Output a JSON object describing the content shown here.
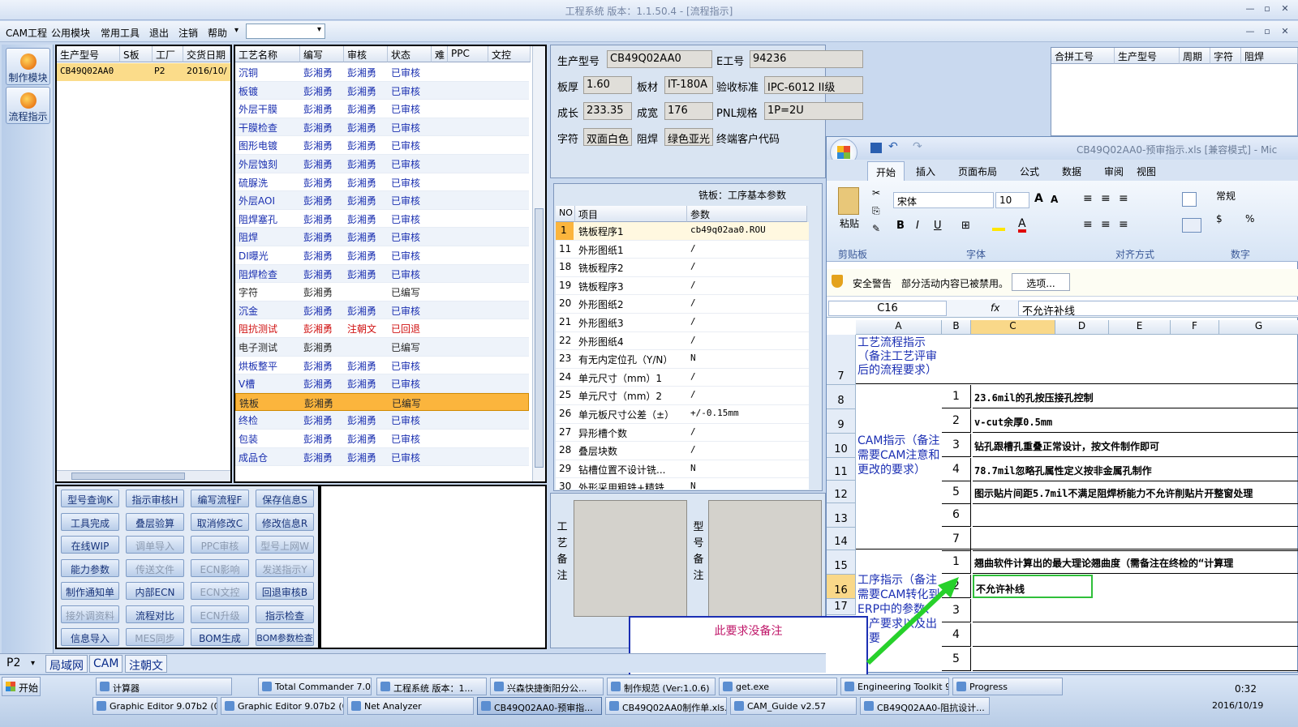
{
  "title": "工程系统  版本：1.1.50.4 - [流程指示]",
  "menu": [
    "CAM工程",
    "公用模块",
    "常用工具",
    "退出",
    "注销",
    "帮助"
  ],
  "menu_arrow": "▾",
  "side": [
    "制作模块",
    "流程指示"
  ],
  "models": {
    "headers": [
      "生产型号",
      "S板",
      "工厂",
      "交货日期"
    ],
    "row": [
      "CB49Q02AA0",
      "P2",
      "2016/10/"
    ]
  },
  "proc": {
    "headers": [
      "工艺名称",
      "编写",
      "审核",
      "状态",
      "难",
      "PPC",
      "文控"
    ],
    "rows": [
      [
        "沉铜",
        "彭湘勇",
        "彭湘勇",
        "已审核"
      ],
      [
        "板镀",
        "彭湘勇",
        "彭湘勇",
        "已审核"
      ],
      [
        "外层干膜",
        "彭湘勇",
        "彭湘勇",
        "已审核"
      ],
      [
        "干膜检查",
        "彭湘勇",
        "彭湘勇",
        "已审核"
      ],
      [
        "图形电镀",
        "彭湘勇",
        "彭湘勇",
        "已审核"
      ],
      [
        "外层蚀刻",
        "彭湘勇",
        "彭湘勇",
        "已审核"
      ],
      [
        "硫脲洗",
        "彭湘勇",
        "彭湘勇",
        "已审核"
      ],
      [
        "外层AOI",
        "彭湘勇",
        "彭湘勇",
        "已审核"
      ],
      [
        "阻焊塞孔",
        "彭湘勇",
        "彭湘勇",
        "已审核"
      ],
      [
        "阻焊",
        "彭湘勇",
        "彭湘勇",
        "已审核"
      ],
      [
        "DI曝光",
        "彭湘勇",
        "彭湘勇",
        "已审核"
      ],
      [
        "阻焊检查",
        "彭湘勇",
        "彭湘勇",
        "已审核"
      ],
      [
        "字符",
        "彭湘勇",
        "",
        "已编写"
      ],
      [
        "沉金",
        "彭湘勇",
        "彭湘勇",
        "已审核"
      ],
      [
        "阻抗测试",
        "彭湘勇",
        "注朝文",
        "已回退"
      ],
      [
        "电子测试",
        "彭湘勇",
        "",
        "已编写"
      ],
      [
        "烘板整平",
        "彭湘勇",
        "彭湘勇",
        "已审核"
      ],
      [
        "V槽",
        "彭湘勇",
        "彭湘勇",
        "已审核"
      ],
      [
        "铣板",
        "彭湘勇",
        "",
        "已编写"
      ],
      [
        "终检",
        "彭湘勇",
        "彭湘勇",
        "已审核"
      ],
      [
        "包装",
        "彭湘勇",
        "彭湘勇",
        "已审核"
      ],
      [
        "成品仓",
        "彭湘勇",
        "彭湘勇",
        "已审核"
      ]
    ]
  },
  "buttons": [
    [
      "型号查询K",
      "指示审核H",
      "编写流程F",
      "保存信息S"
    ],
    [
      "工具完成",
      "叠层验算",
      "取消修改C",
      "修改信息R"
    ],
    [
      "在线WIP",
      "调单导入",
      "PPC审核",
      "型号上网W"
    ],
    [
      "能力参数",
      "传送文件",
      "ECN影响",
      "发送指示Y"
    ],
    [
      "制作通知单",
      "内部ECN",
      "ECN文控",
      "回退审核B"
    ],
    [
      "接外调资料",
      "流程对比",
      "ECN升级",
      "指示检查"
    ],
    [
      "信息导入",
      "MES同步",
      "BOM生成",
      "BOM参数检查"
    ]
  ],
  "info": {
    "型号label": "生产型号",
    "型号": "CB49Q02AA0",
    "E工号label": "E工号",
    "E工号": "94236",
    "板厚label": "板厚",
    "板厚": "1.60",
    "板材label": "板材",
    "板材": "IT-180A",
    "验收label": "验收标准",
    "验收": "IPC-6012 II级",
    "成长label": "成长",
    "成长": "233.35",
    "成宽label": "成宽",
    "成宽": "176",
    "PNL label": "PNL规格",
    "PNL": "1P=2U",
    "字符label": "字符",
    "字符": "双面白色",
    "阻焊label": "阻焊",
    "阻焊": "绿色亚光",
    "终端label": "终端客户代码"
  },
  "merge_headers": [
    "合拼工号",
    "生产型号",
    "周期",
    "字符",
    "阻焊"
  ],
  "params": {
    "title": "铣板：工序基本参数",
    "headers": [
      "NO",
      "项目",
      "参数"
    ],
    "rows": [
      [
        "1",
        "铣板程序1",
        "cb49q02aa0.ROU"
      ],
      [
        "11",
        "外形图纸1",
        "/"
      ],
      [
        "18",
        "铣板程序2",
        "/"
      ],
      [
        "19",
        "铣板程序3",
        "/"
      ],
      [
        "20",
        "外形图纸2",
        "/"
      ],
      [
        "21",
        "外形图纸3",
        "/"
      ],
      [
        "22",
        "外形图纸4",
        "/"
      ],
      [
        "23",
        "有无内定位孔（Y/N）",
        "N"
      ],
      [
        "24",
        "单元尺寸（mm）1",
        "/"
      ],
      [
        "25",
        "单元尺寸（mm）2",
        "/"
      ],
      [
        "26",
        "单元板尺寸公差（±）",
        "+/-0.15mm"
      ],
      [
        "27",
        "异形槽个数",
        "/"
      ],
      [
        "28",
        "叠层块数",
        "/"
      ],
      [
        "29",
        "钻槽位置不设计铣...",
        "N"
      ],
      [
        "30",
        "外形采用粗铣+精铣...",
        "N"
      ]
    ]
  },
  "remark1": "工艺备注",
  "remark2": "型号备注",
  "excel": {
    "title": "CB49Q02AA0-预审指示.xls  [兼容模式] - Mic",
    "tabs": [
      "开始",
      "插入",
      "页面布局",
      "公式",
      "数据",
      "审阅",
      "视图"
    ],
    "font": "宋体",
    "size": "10",
    "format": "常规",
    "groups": [
      "剪贴板",
      "字体",
      "对齐方式",
      "数字"
    ],
    "paste": "粘贴",
    "warn_label": "安全警告",
    "warn_text": "部分活动内容已被禁用。",
    "warn_btn": "选项...",
    "cellref": "C16",
    "fx": "fx",
    "formula": "不允许补线",
    "cols": [
      "A",
      "B",
      "C",
      "D",
      "E",
      "F",
      "G"
    ],
    "rows": [
      "7",
      "8",
      "9",
      "10",
      "11",
      "12",
      "13",
      "14",
      "15",
      "16",
      "17"
    ],
    "a7": "工艺流程指示（备注工艺评审后的流程要求）",
    "a10": "CAM指示（备注需要CAM注意和更改的要求）",
    "a16": "工序指示（备注需要CAM转化到ERP中的参数、生产要求以及出货要",
    "b": [
      "1",
      "2",
      "3",
      "4",
      "5",
      "6",
      "7",
      "1",
      "2",
      "3",
      "4",
      "5"
    ],
    "c": [
      "23.6mil的孔按压接孔控制",
      "v-cut余厚0.5mm",
      "钻孔跟槽孔重叠正常设计，按文件制作即可",
      "78.7mil忽略孔属性定义按非金属孔制作",
      "图示贴片间距5.7mil不满足阻焊桥能力不允许削贴片开整窗处理",
      "",
      "",
      "翘曲软件计算出的最大理论翘曲度（需备注在终检的“计算理",
      "不允许补线",
      "",
      "",
      ""
    ]
  },
  "callout": "此要求没备注",
  "tabs_bottom": [
    "P2",
    "局域网",
    "CAM",
    "注朝文"
  ],
  "taskbar": {
    "start": "开始",
    "row1": [
      "计算器",
      "Total Commander 7.0...",
      "工程系统  版本：1...",
      "兴森快捷衡阳分公...",
      "制作规范 (Ver:1.0.6)",
      "get.exe",
      "Engineering Toolkit 9....",
      "Progress"
    ],
    "row2": [
      "Graphic Editor 9.07b2 (0...",
      "Graphic Editor 9.07b2 (0...",
      "Net Analyzer",
      "CB49Q02AA0-预审指...",
      "CB49Q02AA0制作单.xls...",
      "CAM_Guide v2.57",
      "CB49Q02AA0-阻抗设计..."
    ],
    "time": "0:32",
    "date": "2016/10/19"
  }
}
